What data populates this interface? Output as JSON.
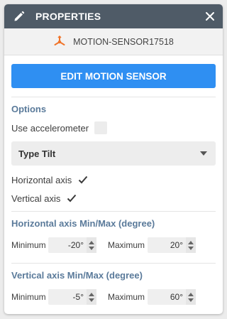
{
  "header": {
    "title": "PROPERTIES",
    "icon": "pencil-icon",
    "close_icon": "close-icon"
  },
  "identity": {
    "icon": "motion-sensor-icon",
    "name": "MOTION-SENSOR17518"
  },
  "edit_button": {
    "label": "EDIT MOTION SENSOR"
  },
  "options": {
    "title": "Options",
    "use_accelerometer": {
      "label": "Use accelerometer",
      "checked": false
    },
    "type_select": {
      "value": "Type Tilt"
    },
    "horizontal_axis": {
      "label": "Horizontal axis",
      "checked": true
    },
    "vertical_axis": {
      "label": "Vertical axis",
      "checked": true
    }
  },
  "horizontal_minmax": {
    "title": "Horizontal axis Min/Max (degree)",
    "min_label": "Minimum",
    "min_value": "-20°",
    "max_label": "Maximum",
    "max_value": "20°"
  },
  "vertical_minmax": {
    "title": "Vertical axis Min/Max (degree)",
    "min_label": "Minimum",
    "min_value": "-5°",
    "max_label": "Maximum",
    "max_value": "60°"
  },
  "colors": {
    "header": "#4f5b67",
    "accent": "#2f8ff2",
    "section_title": "#5a7a9a",
    "sensor_icon": "#f0742a"
  }
}
